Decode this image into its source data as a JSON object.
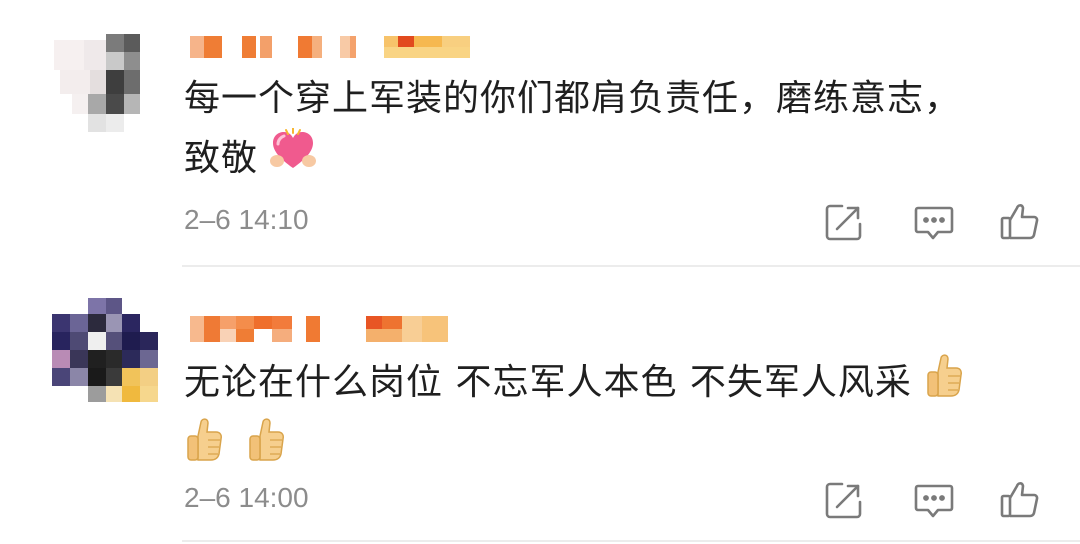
{
  "comments": [
    {
      "text_line1": "每一个穿上军装的你们都肩负责任，磨练意志，",
      "text_line2": "致敬",
      "emoji": "heart-hands-emoji",
      "time": "2–6 14:10",
      "avatar": "pixelated-avatar",
      "username": "obscured-username"
    },
    {
      "text_line1": "无论在什么岗位 不忘军人本色 不失军人风采",
      "emoji": "thumbs-up-emoji",
      "emoji_count": 3,
      "time": "2–6 14:00",
      "avatar": "pixelated-avatar",
      "username": "obscured-username"
    }
  ],
  "icons": {
    "share": "share-icon",
    "reply": "comment-icon",
    "like": "like-icon"
  },
  "colors": {
    "name_orange": "#f08a3c",
    "text": "#1f1f1f",
    "meta": "#8c8c8c",
    "icon": "#7a7a7a"
  }
}
